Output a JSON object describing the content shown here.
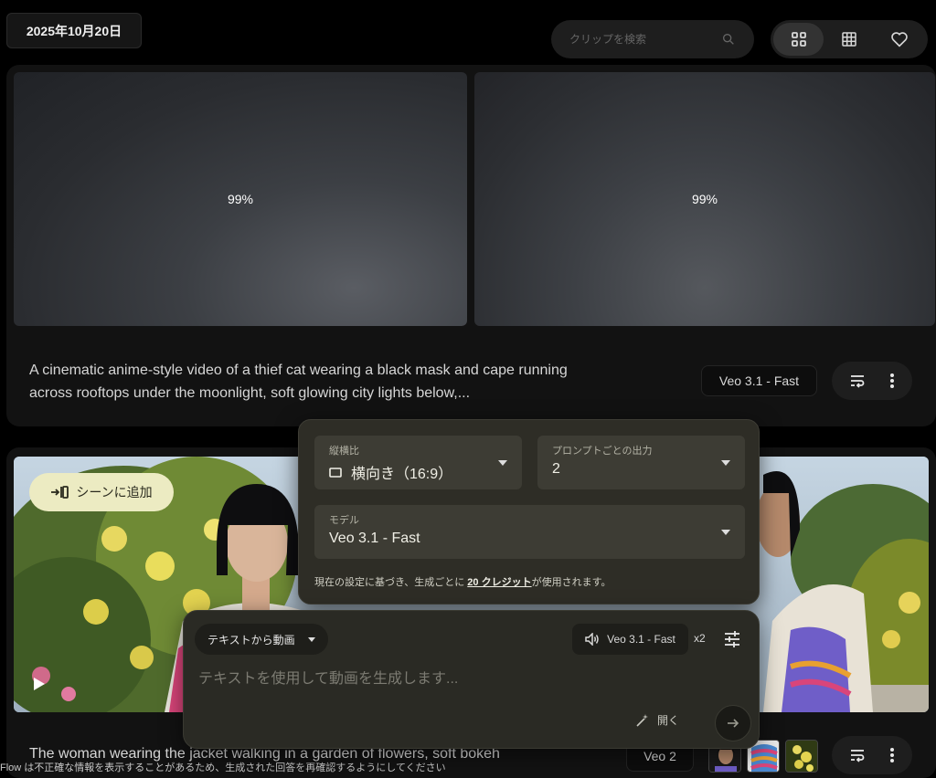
{
  "header": {
    "date": "2025年10月20日",
    "search_placeholder": "クリップを検索",
    "views": [
      "grid-view",
      "table-view",
      "favorites-view"
    ]
  },
  "card1": {
    "thumbs": [
      {
        "progress": "99%"
      },
      {
        "progress": "99%"
      }
    ],
    "prompt": "A cinematic anime-style video of a thief cat wearing a black mask and cape running across rooftops under the moonlight, soft glowing city lights below,...",
    "model": "Veo 3.1 - Fast"
  },
  "card2": {
    "add_scene_label": "シーンに追加",
    "prompt": "The woman wearing the jacket walking in a garden of flowers, soft bokeh",
    "model": "Veo 2"
  },
  "disclaimer": "Flow は不正確な情報を表示することがあるため、生成された回答を再確認するようにしてください",
  "settings": {
    "aspect_label": "縦横比",
    "aspect_value": "横向き（16:9）",
    "outputs_label": "プロンプトごとの出力",
    "outputs_value": "2",
    "model_label": "モデル",
    "model_value": "Veo 3.1 - Fast",
    "note_prefix": "現在の設定に基づき、生成ごとに ",
    "note_link": "20 クレジット",
    "note_suffix": "が使用されます。"
  },
  "composer": {
    "mode": "テキストから動画",
    "model": "Veo 3.1 - Fast",
    "count": "x2",
    "placeholder": "テキストを使用して動画を生成します...",
    "open_label": "開く"
  },
  "colors": {
    "background": "#000000",
    "card": "#121212",
    "popover": "#2e2d26",
    "accent_chip": "#ecebc2"
  }
}
